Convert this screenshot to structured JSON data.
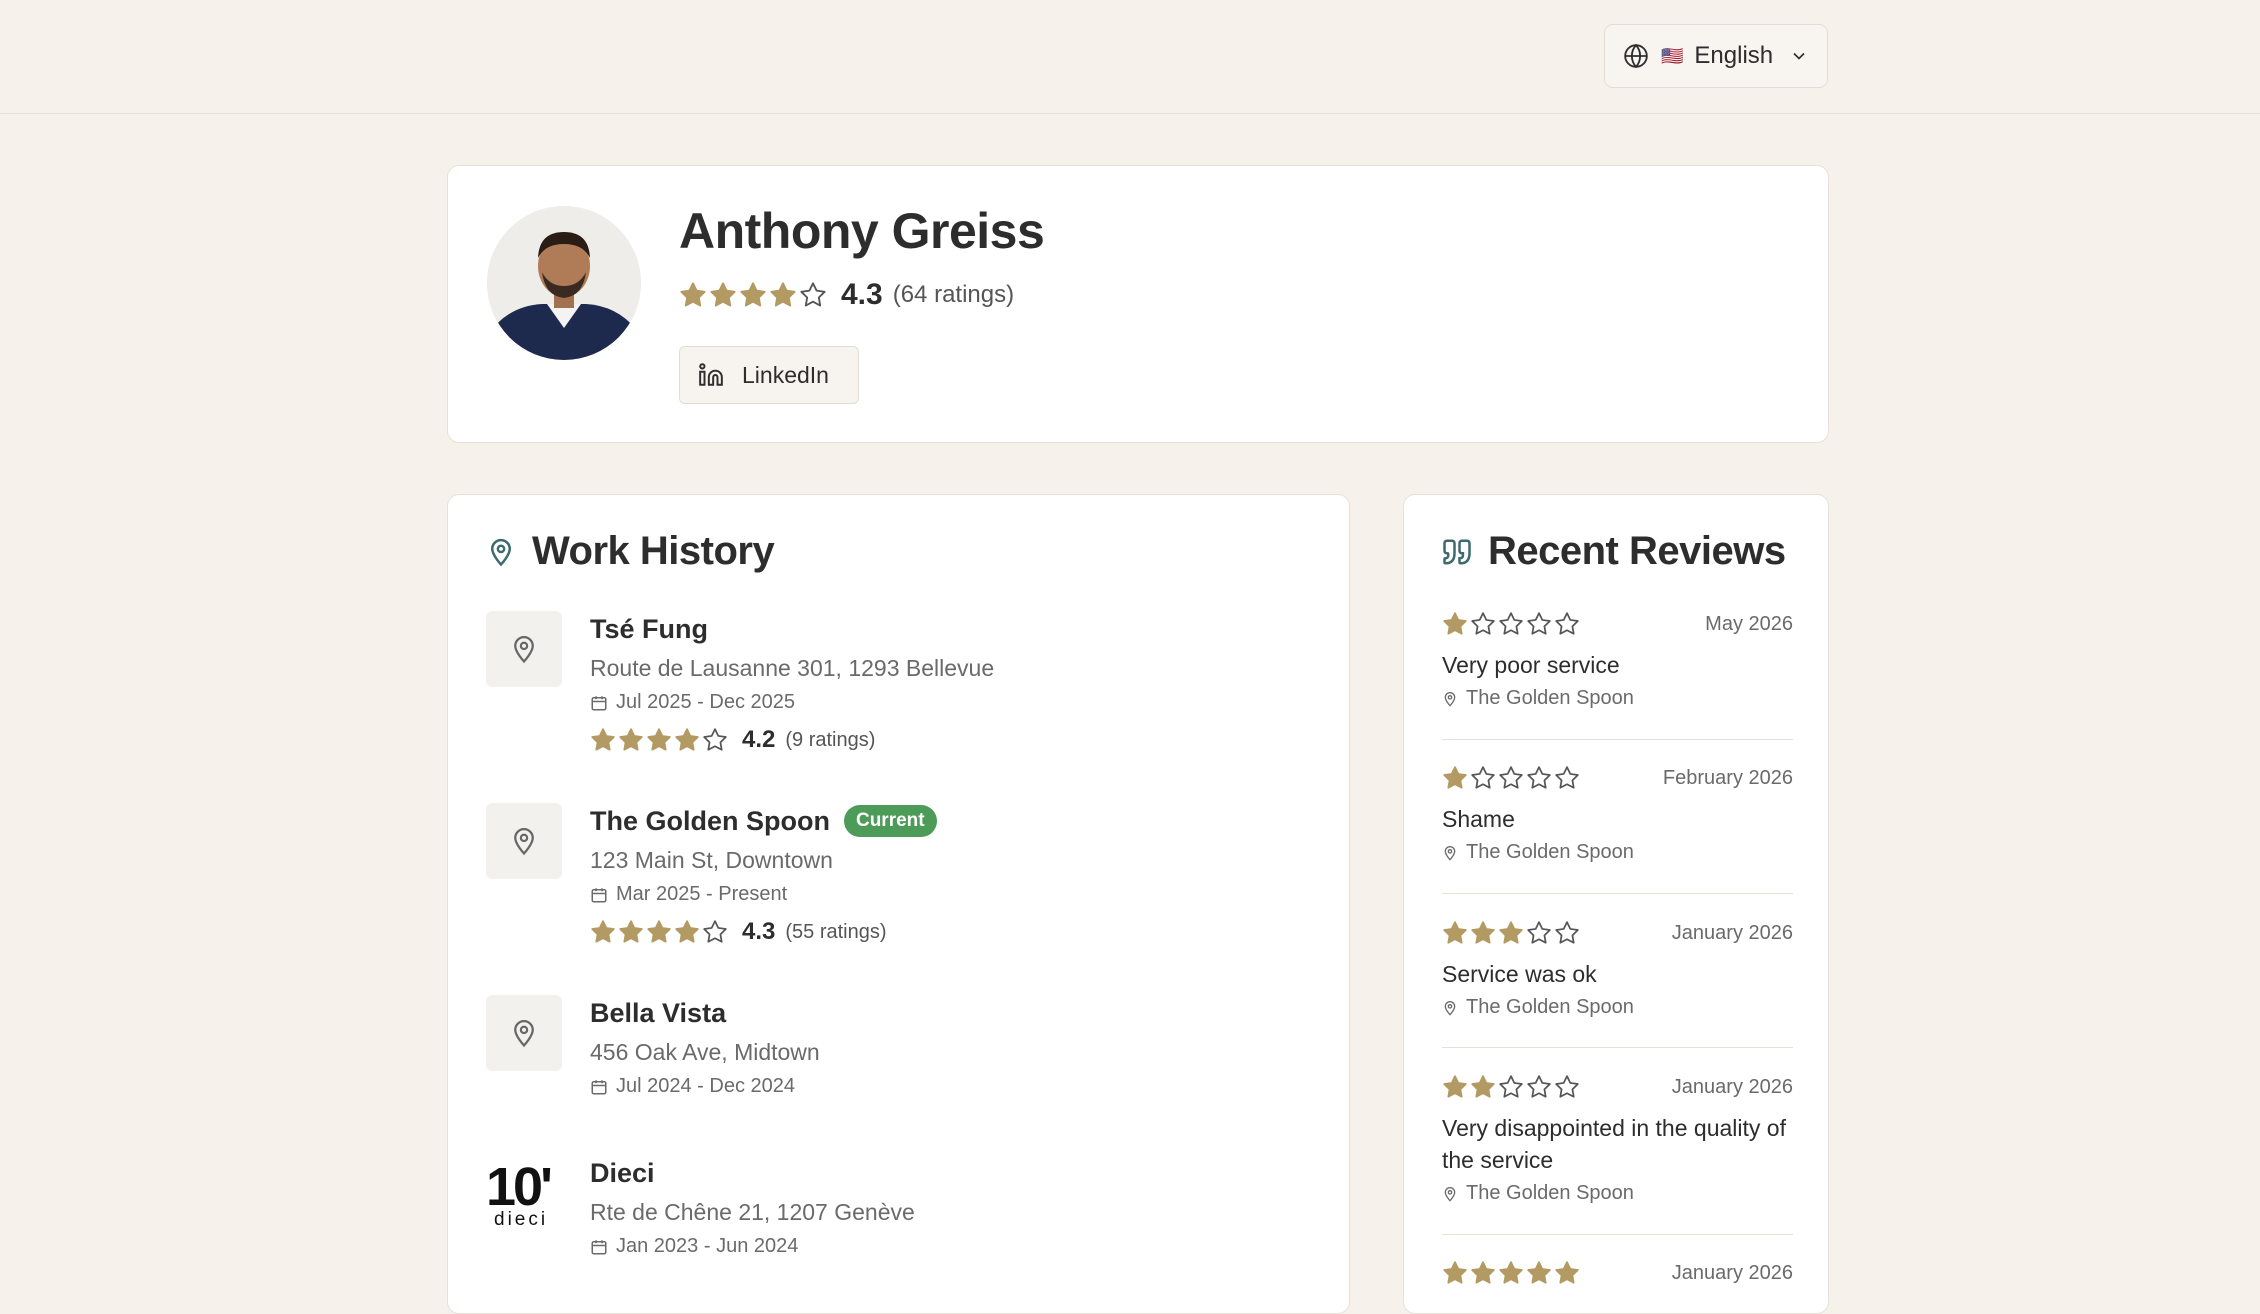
{
  "colors": {
    "star": "#b39a63",
    "badge": "#4d9b58",
    "background": "#f6f2eb"
  },
  "header": {
    "language": {
      "flag": "🇺🇸",
      "label": "English"
    }
  },
  "profile": {
    "name": "Anthony Greiss",
    "rating": "4.3",
    "rating_value": 4.3,
    "rating_count": "(64 ratings)",
    "linkedin_label": "LinkedIn"
  },
  "work_history": {
    "title": "Work History",
    "items": [
      {
        "name": "Tsé Fung",
        "address": "Route de Lausanne 301, 1293 Bellevue",
        "dates": "Jul 2025 - Dec 2025",
        "rating": "4.2",
        "stars": 4,
        "rating_count": "(9 ratings)",
        "current": false
      },
      {
        "name": "The Golden Spoon",
        "badge": "Current",
        "address": "123 Main St, Downtown",
        "dates": "Mar 2025 - Present",
        "rating": "4.3",
        "stars": 4,
        "rating_count": "(55 ratings)",
        "current": true
      },
      {
        "name": "Bella Vista",
        "address": "456 Oak Ave, Midtown",
        "dates": "Jul 2024 - Dec 2024"
      },
      {
        "name": "Dieci",
        "logo_text": "10'",
        "logo_sub": "dieci",
        "address": "Rte de Chêne 21, 1207 Genève",
        "dates": "Jan 2023 - Jun 2024"
      }
    ]
  },
  "recent_reviews": {
    "title": "Recent Reviews",
    "items": [
      {
        "stars": 1,
        "date": "May 2026",
        "text": "Very poor service",
        "place": "The Golden Spoon"
      },
      {
        "stars": 1,
        "date": "February 2026",
        "text": "Shame",
        "place": "The Golden Spoon"
      },
      {
        "stars": 3,
        "date": "January 2026",
        "text": "Service was ok",
        "place": "The Golden Spoon"
      },
      {
        "stars": 2,
        "date": "January 2026",
        "text": "Very disappointed in the quality of the service",
        "place": "The Golden Spoon"
      },
      {
        "stars": 5,
        "date": "January 2026"
      }
    ]
  }
}
